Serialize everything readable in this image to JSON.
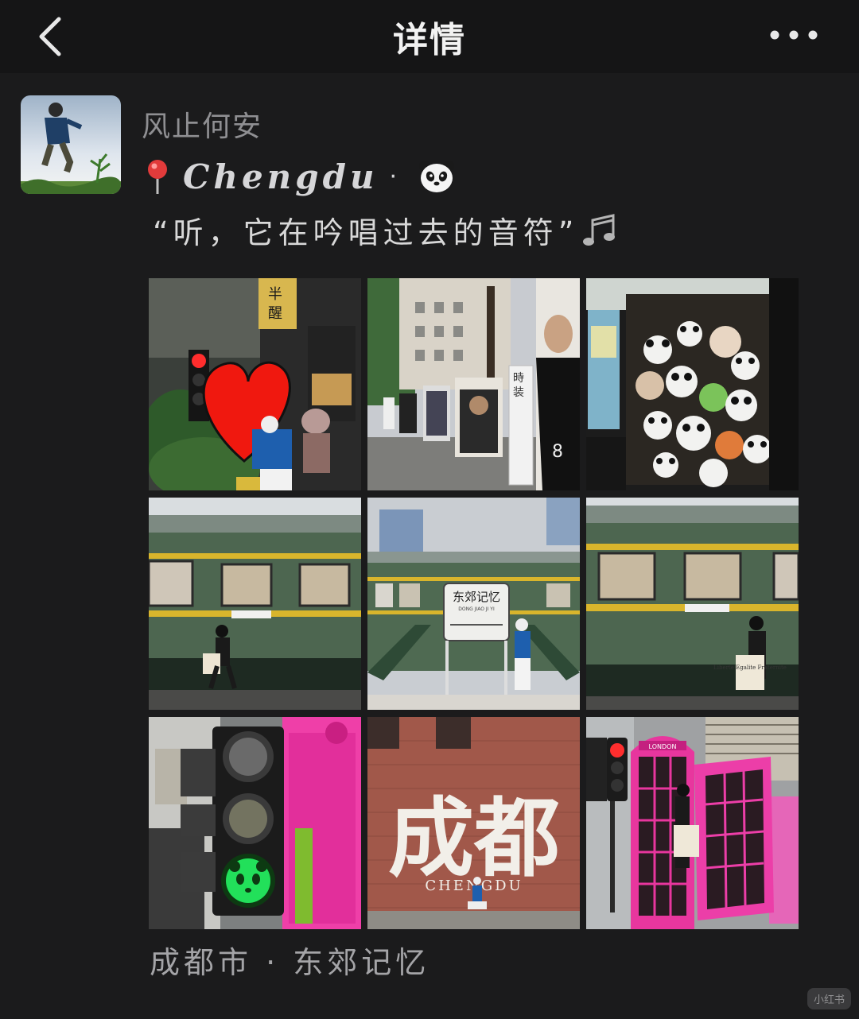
{
  "header": {
    "title": "详情"
  },
  "post": {
    "author": "风止何安",
    "location_tag": "Chengdu",
    "separator": "·",
    "caption": "“听，它在吟唱过去的音符”",
    "footer_location": "成都市 · 东郊记忆"
  },
  "photos": [
    {
      "label": "半醒 (Half Drunk) café with red heart and traffic light"
    },
    {
      "label": "时装 magazine cover displays along the street"
    },
    {
      "label": "Shop window full of panda plush toys"
    },
    {
      "label": "Green train carriage with person walking"
    },
    {
      "label": "东郊记忆 station sign",
      "sign_text": "东郊记忆",
      "sign_sub": "DONG JIAO JI YI"
    },
    {
      "label": "Green train carriage with person posing",
      "bag_text": "Liberte Egalite Fraternite"
    },
    {
      "label": "Traffic light with green panda face"
    },
    {
      "label": "成都 wall mural",
      "mural_text": "成都",
      "mural_sub": "CHENGDU"
    },
    {
      "label": "Pink telephone booth",
      "booth_text": "LONDON"
    }
  ],
  "watermark": "小红书",
  "colors": {
    "background": "#1b1b1c",
    "topbar": "#151516",
    "train_green": "#4d6650",
    "train_stripe": "#d9b52c",
    "pink": "#e84caa"
  }
}
